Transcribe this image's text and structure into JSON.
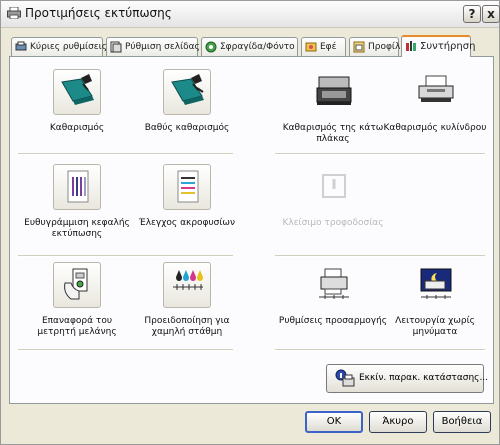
{
  "window": {
    "title": "Προτιμήσεις εκτύπωσης",
    "help_label": "?",
    "close_label": "x"
  },
  "tabs": [
    {
      "label": "Κύριες ρυθμίσεις",
      "icon": "main-settings-icon"
    },
    {
      "label": "Ρύθμιση σελίδας",
      "icon": "page-setup-icon"
    },
    {
      "label": "Σφραγίδα/Φόντο",
      "icon": "stamp-icon"
    },
    {
      "label": "Εφέ",
      "icon": "effects-icon"
    },
    {
      "label": "Προφίλ",
      "icon": "profile-icon"
    },
    {
      "label": "Συντήρηση",
      "icon": "maintenance-icon",
      "active": true
    }
  ],
  "items": [
    {
      "label": "Καθαρισμός",
      "icon": "cleaning-icon",
      "enabled": true
    },
    {
      "label": "Βαθύς καθαρισμός",
      "icon": "deep-cleaning-icon",
      "enabled": true
    },
    {
      "label": "Καθαρισμός της κάτω πλάκας",
      "icon": "bottom-plate-cleaning-icon",
      "enabled": true
    },
    {
      "label": "Καθαρισμός κυλίνδρου",
      "icon": "roller-cleaning-icon",
      "enabled": true
    },
    {
      "label": "Ευθυγράμμιση κεφαλής εκτύπωσης",
      "icon": "print-head-alignment-icon",
      "enabled": true
    },
    {
      "label": "Έλεγχος ακροφυσίων",
      "icon": "nozzle-check-icon",
      "enabled": true
    },
    {
      "label": "Κλείσιμο τροφοδοσίας",
      "icon": "power-off-icon",
      "enabled": false
    },
    {
      "label": "Επαναφορά του μετρητή μελάνης",
      "icon": "ink-counter-reset-icon",
      "enabled": true
    },
    {
      "label": "Προειδοποίηση για χαμηλή στάθμη",
      "icon": "low-ink-warning-icon",
      "enabled": true
    },
    {
      "label": "Ρυθμίσεις προσαρμογής",
      "icon": "custom-settings-icon",
      "enabled": true
    },
    {
      "label": "Λειτουργία χωρίς μηνύματα",
      "icon": "quiet-mode-icon",
      "enabled": true
    }
  ],
  "status_button": {
    "label": "Εκκίν. παρακ. κατάστασης...",
    "icon": "status-monitor-icon"
  },
  "footer": {
    "ok_label": "OK",
    "cancel_label": "Άκυρο",
    "help_label": "Βοήθεια"
  },
  "colors": {
    "active_tab_accent": "#e68b2c",
    "default_button_border": "#3c64c8",
    "panel_bg": "#fcfcfe",
    "window_bg": "#ece9d8"
  }
}
